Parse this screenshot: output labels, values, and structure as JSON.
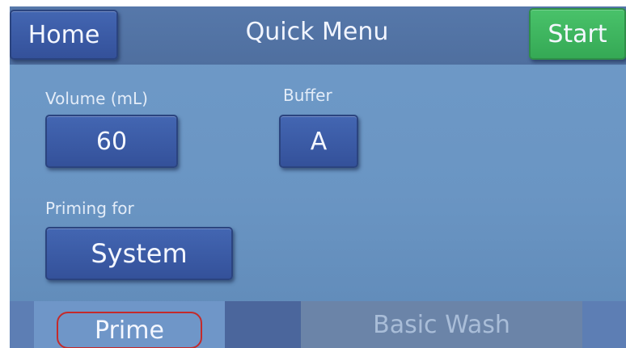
{
  "header": {
    "home_label": "Home",
    "title": "Quick Menu",
    "start_label": "Start"
  },
  "fields": {
    "volume_label": "Volume (mL)",
    "volume_value": "60",
    "buffer_label": "Buffer",
    "buffer_value": "A",
    "priming_label": "Priming for",
    "priming_value": "System"
  },
  "tabs": [
    {
      "label": "Prime",
      "selected": true
    },
    {
      "label": "Basic Wash",
      "selected": false
    }
  ],
  "colors": {
    "screen_bg": "#6f9ac8",
    "button_blue": "#3d5ea8",
    "start_green": "#3fb860",
    "highlight_red": "#c42a2a"
  }
}
